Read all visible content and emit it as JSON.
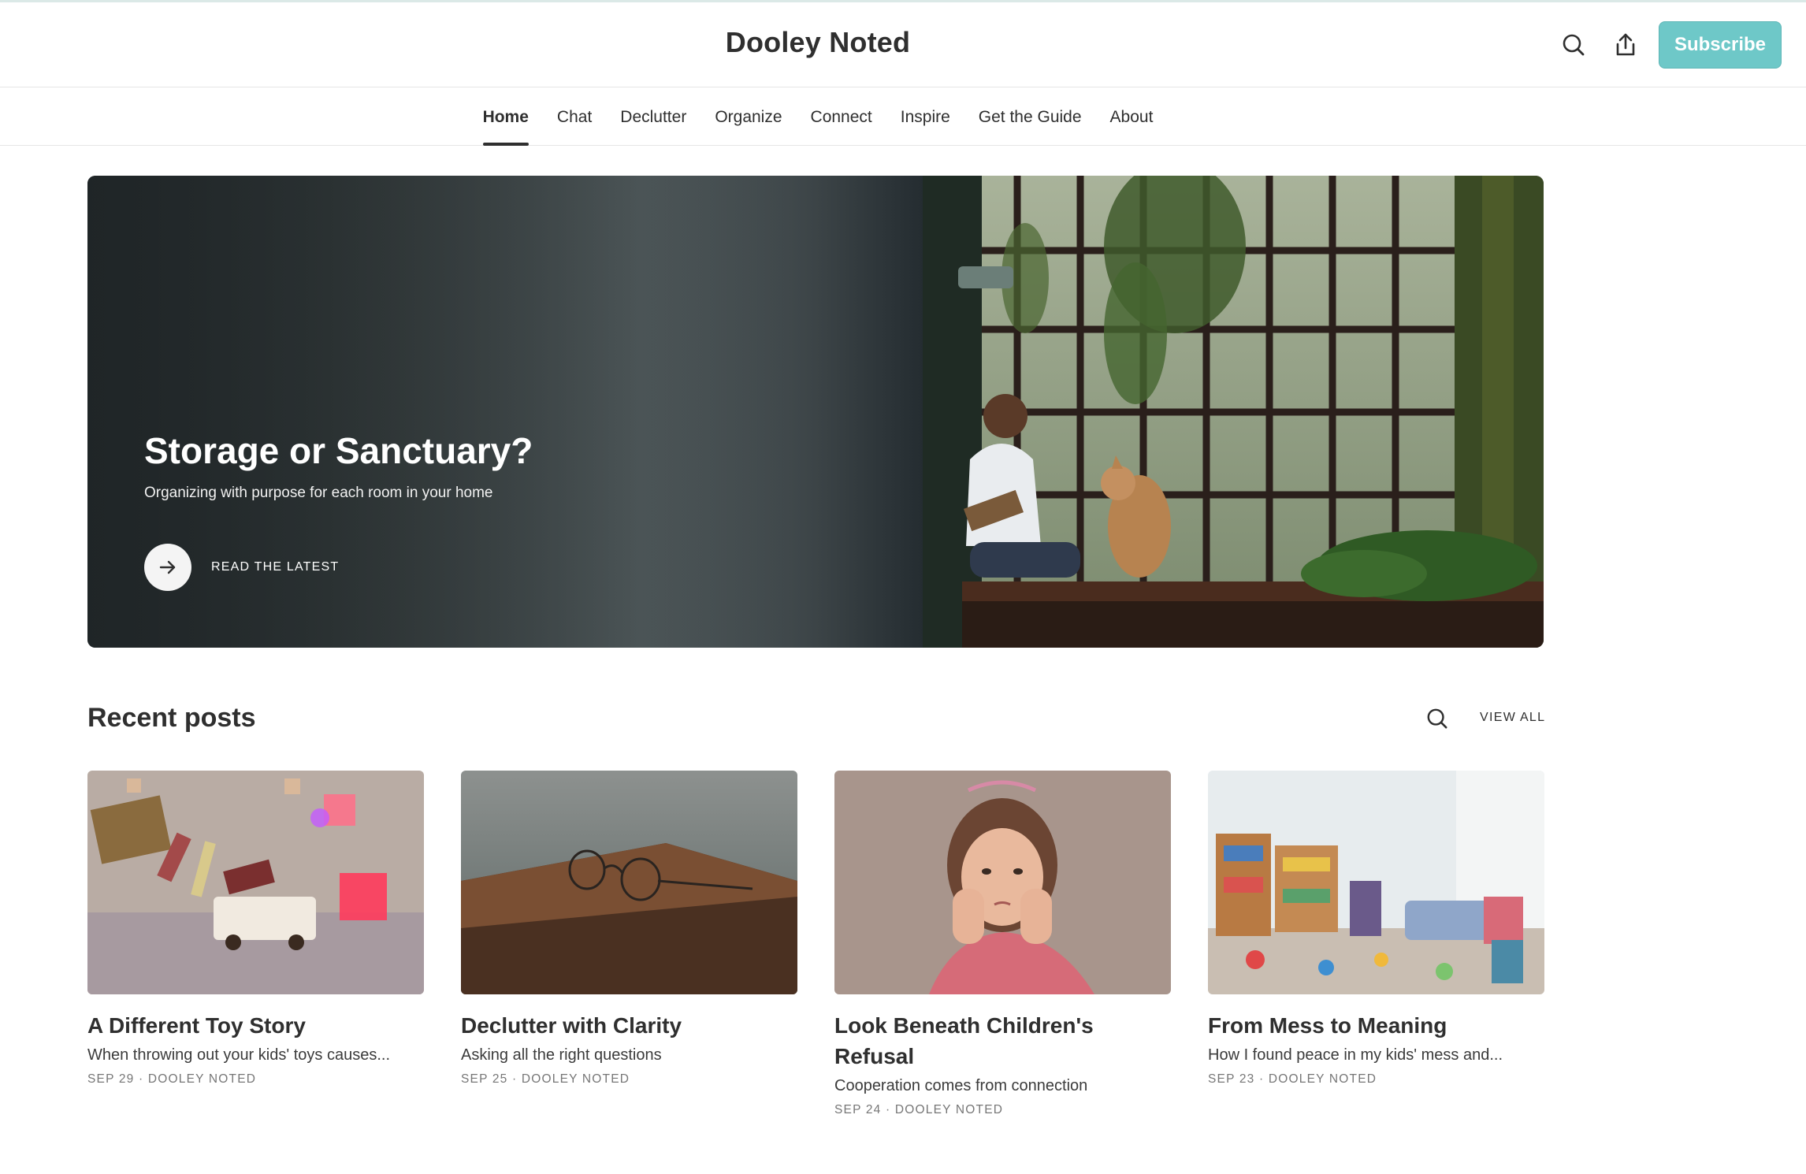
{
  "header": {
    "site_title": "Dooley Noted",
    "subscribe_label": "Subscribe"
  },
  "nav": {
    "items": [
      {
        "label": "Home",
        "active": true
      },
      {
        "label": "Chat"
      },
      {
        "label": "Declutter"
      },
      {
        "label": "Organize"
      },
      {
        "label": "Connect"
      },
      {
        "label": "Inspire"
      },
      {
        "label": "Get the Guide"
      },
      {
        "label": "About"
      }
    ]
  },
  "hero": {
    "title": "Storage or Sanctuary?",
    "subtitle": "Organizing with purpose for each room in your home",
    "cta_label": "READ THE LATEST"
  },
  "recent": {
    "title": "Recent posts",
    "view_all_label": "VIEW ALL",
    "posts": [
      {
        "title": "A Different Toy Story",
        "subtitle": "When throwing out your kids' toys causes...",
        "meta": "SEP 29 · DOOLEY NOTED"
      },
      {
        "title": "Declutter with Clarity",
        "subtitle": "Asking all the right questions",
        "meta": "SEP 25 · DOOLEY NOTED"
      },
      {
        "title": "Look Beneath Children's Refusal",
        "subtitle": "Cooperation comes from connection",
        "meta": "SEP 24 · DOOLEY NOTED"
      },
      {
        "title": "From Mess to Meaning",
        "subtitle": "How I found peace in my kids' mess and...",
        "meta": "SEP 23 · DOOLEY NOTED"
      }
    ]
  },
  "colors": {
    "accent": "#6ec8c8",
    "text": "#2f2f2f",
    "meta": "#767676"
  }
}
